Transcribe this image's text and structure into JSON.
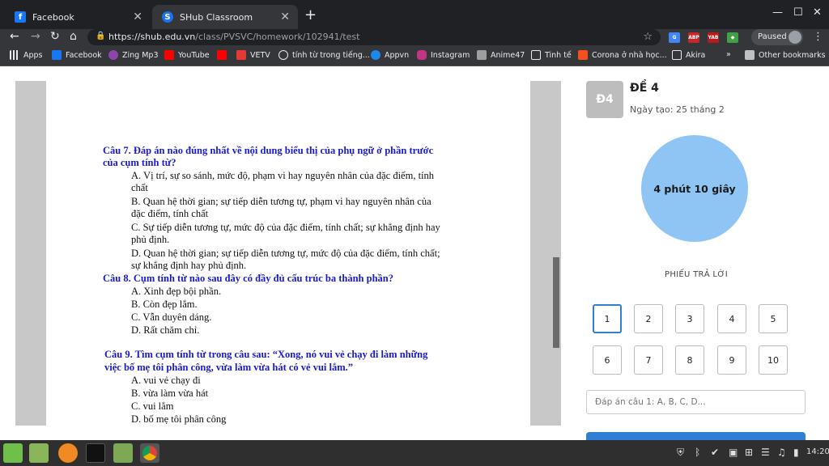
{
  "browser": {
    "tabs": [
      {
        "label": "Facebook",
        "color": "#1877f2"
      },
      {
        "label": "SHub Classroom",
        "color": "#1a73e8"
      }
    ],
    "url_host": "https://shub.edu.vn",
    "url_path": "/class/PVSVC/homework/102941/test",
    "paused_label": "Paused",
    "bookmarks": [
      {
        "label": "Apps",
        "color": "#e8eaed"
      },
      {
        "label": "Facebook",
        "color": "#1877f2"
      },
      {
        "label": "Zing Mp3",
        "color": "#8e44ad"
      },
      {
        "label": "YouTube",
        "color": "#ff0000"
      },
      {
        "label": "",
        "color": "#ff0000"
      },
      {
        "label": "VETV",
        "color": "#e53935"
      },
      {
        "label": "tính từ trong tiếng...",
        "color": "#e8eaed"
      },
      {
        "label": "Appvn",
        "color": "#1e88e5"
      },
      {
        "label": "Instagram",
        "color": "#c13584"
      },
      {
        "label": "Anime47",
        "color": "#9e9e9e"
      },
      {
        "label": "Tinh tế",
        "color": "#e8eaed"
      },
      {
        "label": "Corona ở nhà học...",
        "color": "#f4511e"
      },
      {
        "label": "Akira",
        "color": "#e8eaed"
      },
      {
        "label": "Other bookmarks",
        "color": "#e8eaed"
      }
    ]
  },
  "document": {
    "q7": {
      "title_1": "Câu 7. Đáp án nào đúng nhất về nội dung biểu thị của phụ ngữ ở phần trước",
      "title_2": "của cụm tính từ?",
      "a_1": "A. Vị trí, sự so sánh, mức độ, phạm vi hay nguyên nhân của đặc điểm, tính",
      "a_2": "chất",
      "b_1": "B. Quan hệ thời gian; sự tiếp diễn tương tự, phạm vi hay nguyên nhân của",
      "b_2": "đặc điểm, tính chất",
      "c_1": "C. Sự tiếp diễn tương tự, mức độ của đặc điểm, tính chất; sự khẳng định hay",
      "c_2": "phủ định.",
      "d_1": "D. Quan hệ thời gian; sự tiếp diễn tương tự, mức độ của đặc điểm, tính chất;",
      "d_2": "sự khẳng định hay phủ định."
    },
    "q8": {
      "title": "Câu 8. Cụm tính từ nào sau đây có đầy đủ cấu trúc ba thành phần?",
      "a": "A. Xinh đẹp bội phần.",
      "b": "B. Còn đẹp lắm.",
      "c": "C. Vẫn duyên dáng.",
      "d": "D. Rất chăm chỉ."
    },
    "q9": {
      "title_1": "Câu 9. Tìm cụm tính từ trong câu sau: “Xong, nó vui vẻ chạy đi làm những",
      "title_2": "việc bố mẹ tôi phân công, vừa làm vừa hát có vẻ vui lắm.”",
      "a": "A. vui vẻ chạy đi",
      "b": "B. vừa làm vừa hát",
      "c": "C. vui lắm",
      "d": "D. bố mẹ tôi phân công"
    }
  },
  "panel": {
    "badge": "Đ4",
    "title": "ĐỀ 4",
    "created": "Ngày tạo: 25 tháng 2",
    "timer": "4 phút 10 giây",
    "sheet_label": "PHIẾU TRẢ LỜI",
    "answers": [
      "1",
      "2",
      "3",
      "4",
      "5",
      "6",
      "7",
      "8",
      "9",
      "10"
    ],
    "active_answer": "1",
    "answer_placeholder": "Đáp án câu 1: A, B, C, D...",
    "accent": "#2f7fd6",
    "timer_color": "#8ec5f5"
  },
  "taskbar": {
    "clock": "14:20"
  }
}
